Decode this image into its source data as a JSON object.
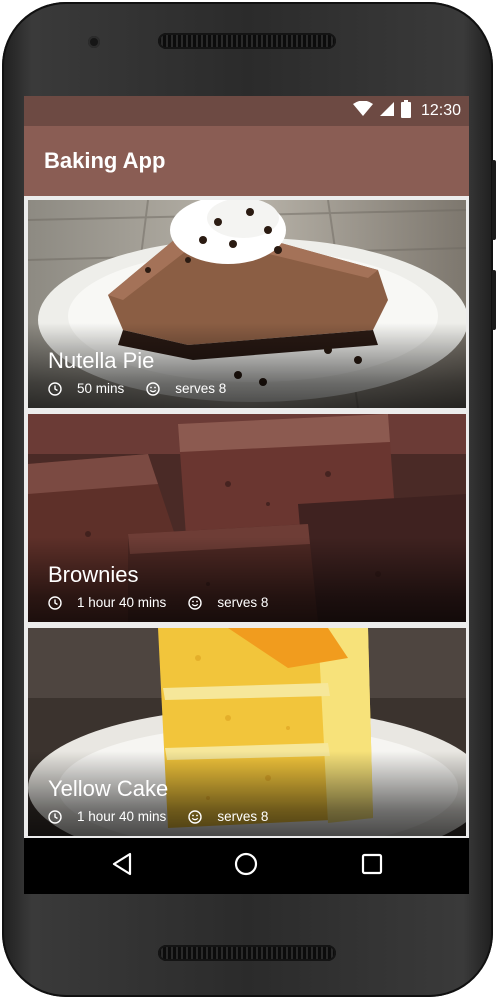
{
  "status_bar": {
    "time": "12:30",
    "icons": [
      "wifi-icon",
      "cellular-signal-icon",
      "battery-icon"
    ]
  },
  "app_bar": {
    "title": "Baking App"
  },
  "recipes": [
    {
      "name": "Nutella Pie",
      "time": "50 mins",
      "servings": "serves 8",
      "image": "chocolate-pie-photo"
    },
    {
      "name": "Brownies",
      "time": "1 hour 40 mins",
      "servings": "serves 8",
      "image": "brownies-photo"
    },
    {
      "name": "Yellow Cake",
      "time": "1 hour 40 mins",
      "servings": "serves 8",
      "image": "yellow-cake-photo"
    }
  ],
  "navigation_bar": {
    "buttons": [
      "back-icon",
      "home-icon",
      "recents-icon"
    ]
  },
  "colors": {
    "status_bar": "#6d4a43",
    "app_bar": "#8a5d54",
    "list_background": "#ececec",
    "nav_bar": "#000000"
  }
}
